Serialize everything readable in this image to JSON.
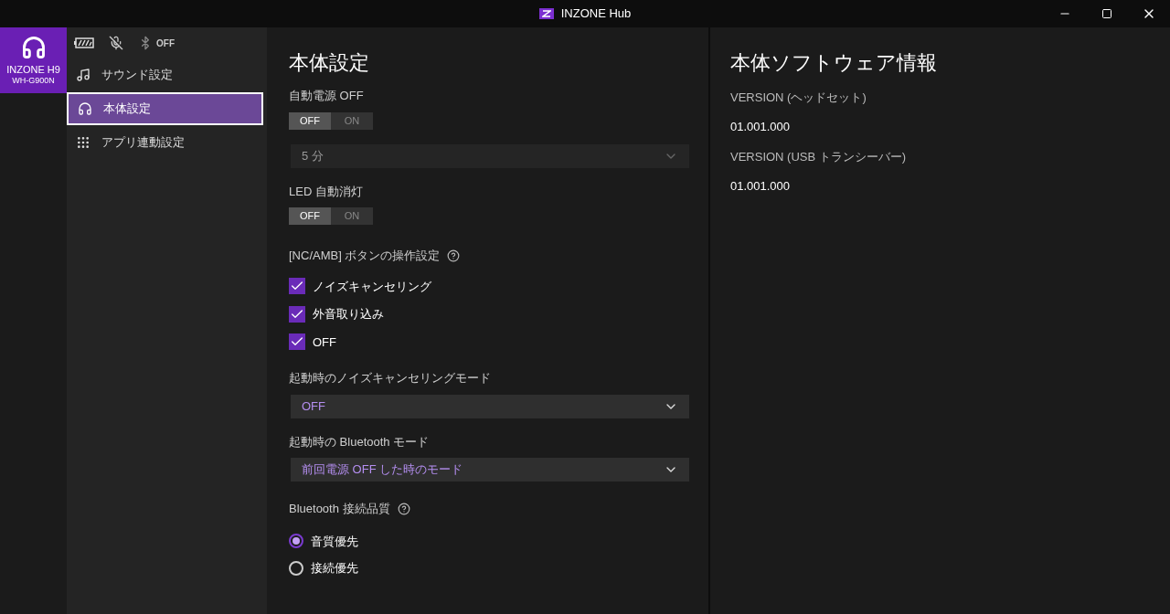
{
  "window": {
    "title": "INZONE Hub"
  },
  "device": {
    "name": "INZONE H9",
    "model": "WH-G900N",
    "selected": true
  },
  "status": {
    "mic_muted": true,
    "bluetooth": "OFF"
  },
  "nav": [
    {
      "kind": "music",
      "label": "サウンド設定",
      "selected": false
    },
    {
      "kind": "headphones",
      "label": "本体設定",
      "selected": true
    },
    {
      "kind": "grid",
      "label": "アプリ連動設定",
      "selected": false
    }
  ],
  "main": {
    "title": "本体設定",
    "sections": [
      {
        "kind": "toggle",
        "label": "自動電源 OFF",
        "options": [
          {
            "label": "OFF",
            "selected": true
          },
          {
            "label": "ON",
            "selected": false
          }
        ]
      },
      {
        "kind": "select",
        "value": "5 分",
        "disabled": true
      },
      {
        "kind": "toggle",
        "label": "LED 自動消灯",
        "options": [
          {
            "label": "OFF",
            "selected": true
          },
          {
            "label": "ON",
            "selected": false
          }
        ]
      },
      {
        "kind": "checks",
        "label": "[NC/AMB] ボタンの操作設定",
        "help": true,
        "items": [
          {
            "label": "ノイズキャンセリング",
            "checked": true
          },
          {
            "label": "外音取り込み",
            "checked": true
          },
          {
            "label": "OFF",
            "checked": true
          }
        ]
      },
      {
        "kind": "select",
        "label": "起動時のノイズキャンセリングモード",
        "value": "OFF",
        "disabled": false
      },
      {
        "kind": "select",
        "label": "起動時の Bluetooth モード",
        "value": "前回電源 OFF した時のモード",
        "disabled": false
      },
      {
        "kind": "radios",
        "label": "Bluetooth 接続品質",
        "help": true,
        "items": [
          {
            "label": "音質優先",
            "selected": true
          },
          {
            "label": "接続優先",
            "selected": false
          }
        ]
      }
    ]
  },
  "info": {
    "title": "本体ソフトウェア情報",
    "entries": [
      {
        "label": "VERSION (ヘッドセット)",
        "value": "01.001.000"
      },
      {
        "label": "VERSION (USB トランシーバー)",
        "value": "01.001.000"
      }
    ]
  }
}
